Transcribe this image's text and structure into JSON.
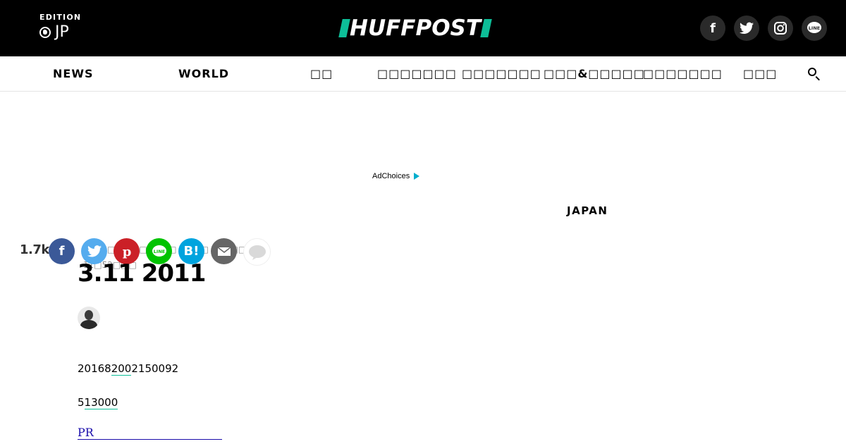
{
  "header": {
    "edition_label": "EDITION",
    "edition_code": "JP",
    "logo": "HUFFPOST",
    "socials": [
      {
        "icon": "facebook-icon",
        "glyph": "f"
      },
      {
        "icon": "twitter-icon",
        "glyph": "🐦"
      },
      {
        "icon": "instagram-icon",
        "glyph": "◎"
      },
      {
        "icon": "line-icon",
        "glyph": "LINE"
      }
    ]
  },
  "nav": {
    "items": [
      "NEWS",
      "WORLD",
      "□□",
      "□□□□□□□",
      "□□□□□□□",
      "□□□&□□□□□",
      "□□□□□□□",
      "□□□"
    ]
  },
  "ad": {
    "adchoices": "AdChoices"
  },
  "section": "JAPAN",
  "share": {
    "count": "1.7k",
    "buttons": [
      {
        "icon": "facebook-icon",
        "glyph": "f",
        "color": "#3b5998"
      },
      {
        "icon": "twitter-icon",
        "glyph": "🐦",
        "color": "#55acee"
      },
      {
        "icon": "pinterest-icon",
        "glyph": "P",
        "color": "#cb2027"
      },
      {
        "icon": "line-icon",
        "glyph": "LINE",
        "color": "#00c300"
      },
      {
        "icon": "hatena-icon",
        "glyph": "B!",
        "color": "#00a4de"
      },
      {
        "icon": "mail-icon",
        "glyph": "✉",
        "color": "#666666"
      },
      {
        "icon": "comment-icon",
        "glyph": "",
        "color": "#dddddd"
      }
    ]
  },
  "article": {
    "meta": "□□□□□□□□ 27□□ | □□□ 17□□□11□ 11□52□□□",
    "title": "3.11 2011",
    "para1_a": "20168",
    "para1_link": "200",
    "para1_b": "2150092",
    "para2_a": "5",
    "para2_link": "13000",
    "pr": "PR"
  }
}
